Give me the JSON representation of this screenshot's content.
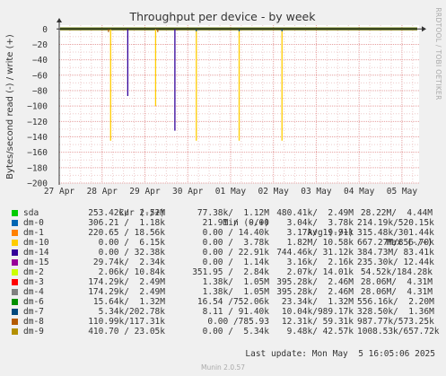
{
  "chart_data": {
    "type": "line",
    "title": "Throughput per device - by week",
    "ylabel": "Bytes/second read (-) / write (+)",
    "side_label": "RRDTOOL / TOBI OETIKER",
    "ylim": [
      -200,
      5
    ],
    "y_ticks": [
      0,
      -20,
      -40,
      -60,
      -80,
      -100,
      -120,
      -140,
      -160,
      -180,
      -200
    ],
    "y_tick_labels": [
      "0",
      "−20",
      "−40",
      "−60",
      "−80",
      "−100",
      "−120",
      "−140",
      "−160",
      "−180",
      "−200"
    ],
    "x_ticks": [
      "27 Apr",
      "28 Apr",
      "29 Apr",
      "30 Apr",
      "01 May",
      "02 May",
      "03 May",
      "04 May",
      "05 May"
    ],
    "x_tick_values": [
      0,
      1,
      2,
      3,
      4,
      5,
      6,
      7,
      8
    ],
    "xlim": [
      0,
      8.4
    ],
    "grid": true,
    "spikes": [
      {
        "series": "dm-10",
        "x": 1.2,
        "y": -145
      },
      {
        "series": "dm-8",
        "x": 1.15,
        "y": -4
      },
      {
        "series": "dm-14",
        "x": 1.6,
        "y": -87
      },
      {
        "series": "dm-10",
        "x": 2.25,
        "y": -100
      },
      {
        "series": "dm-8",
        "x": 2.3,
        "y": -4
      },
      {
        "series": "dm-14",
        "x": 2.7,
        "y": -132
      },
      {
        "series": "dm-10",
        "x": 3.2,
        "y": -145
      },
      {
        "series": "dm-7",
        "x": 3.2,
        "y": -3
      },
      {
        "series": "dm-10",
        "x": 4.2,
        "y": -145
      },
      {
        "series": "dm-7",
        "x": 4.2,
        "y": -3
      },
      {
        "series": "dm-10",
        "x": 5.2,
        "y": -145
      },
      {
        "series": "dm-7",
        "x": 5.2,
        "y": -3
      }
    ]
  },
  "legend": {
    "headers": {
      "cur": "Cur (-/+)",
      "min": "Min (-/+)",
      "avg": "Avg (-/+)",
      "max": "Max (-/+)"
    },
    "rows": [
      {
        "name": "sda",
        "color": "#00cc00",
        "cur": "253.42k/  2.52M",
        "min": "77.38k/  1.12M",
        "avg": "480.41k/  2.49M",
        "max": "28.22M/  4.44M"
      },
      {
        "name": "dm-0",
        "color": "#0066b3",
        "cur": "306.21 /  1.18k",
        "min": "21.91 /  0.00",
        "avg": "3.04k/  3.78k",
        "max": "214.19k/520.15k"
      },
      {
        "name": "dm-1",
        "color": "#ff8000",
        "cur": "220.65 / 18.56k",
        "min": "0.00 / 14.40k",
        "avg": "3.17k/ 19.91k",
        "max": "315.48k/301.44k"
      },
      {
        "name": "dm-10",
        "color": "#ffcc00",
        "cur": "0.00 /  6.15k",
        "min": "0.00 /  3.78k",
        "avg": "1.82M/ 10.58k",
        "max": "667.27M/856.70k"
      },
      {
        "name": "dm-14",
        "color": "#330099",
        "cur": "0.00 / 32.38k",
        "min": "0.00 / 22.91k",
        "avg": "744.46k/ 31.12k",
        "max": "384.73M/ 83.41k"
      },
      {
        "name": "dm-15",
        "color": "#990099",
        "cur": "29.74k/  2.34k",
        "min": "0.00 /  1.14k",
        "avg": "3.16k/  2.16k",
        "max": "235.30k/ 12.44k"
      },
      {
        "name": "dm-2",
        "color": "#ccff00",
        "cur": "2.06k/ 10.84k",
        "min": "351.95 /  2.84k",
        "avg": "2.07k/ 14.01k",
        "max": "54.52k/184.28k"
      },
      {
        "name": "dm-3",
        "color": "#ff0000",
        "cur": "174.29k/  2.49M",
        "min": "1.38k/  1.05M",
        "avg": "395.28k/  2.46M",
        "max": "28.06M/  4.31M"
      },
      {
        "name": "dm-4",
        "color": "#808080",
        "cur": "174.29k/  2.49M",
        "min": "1.38k/  1.05M",
        "avg": "395.28k/  2.46M",
        "max": "28.06M/  4.31M"
      },
      {
        "name": "dm-6",
        "color": "#008f00",
        "cur": "15.64k/  1.32M",
        "min": "16.54 /752.06k",
        "avg": "23.34k/  1.32M",
        "max": "556.16k/  2.20M"
      },
      {
        "name": "dm-7",
        "color": "#00487d",
        "cur": "5.34k/202.78k",
        "min": "8.11 / 91.40k",
        "avg": "10.04k/989.17k",
        "max": "328.50k/  1.36M"
      },
      {
        "name": "dm-8",
        "color": "#b35a00",
        "cur": "110.99k/117.31k",
        "min": "0.00 /785.93",
        "avg": "12.31k/ 59.31k",
        "max": "987.77k/573.25k"
      },
      {
        "name": "dm-9",
        "color": "#b38f00",
        "cur": "410.70 / 23.05k",
        "min": "0.00 /  5.34k",
        "avg": "9.48k/ 42.57k",
        "max": "1008.53k/657.72k"
      }
    ]
  },
  "last_update": "Last update: Mon May  5 16:05:06 2025",
  "footer": "Munin 2.0.57"
}
